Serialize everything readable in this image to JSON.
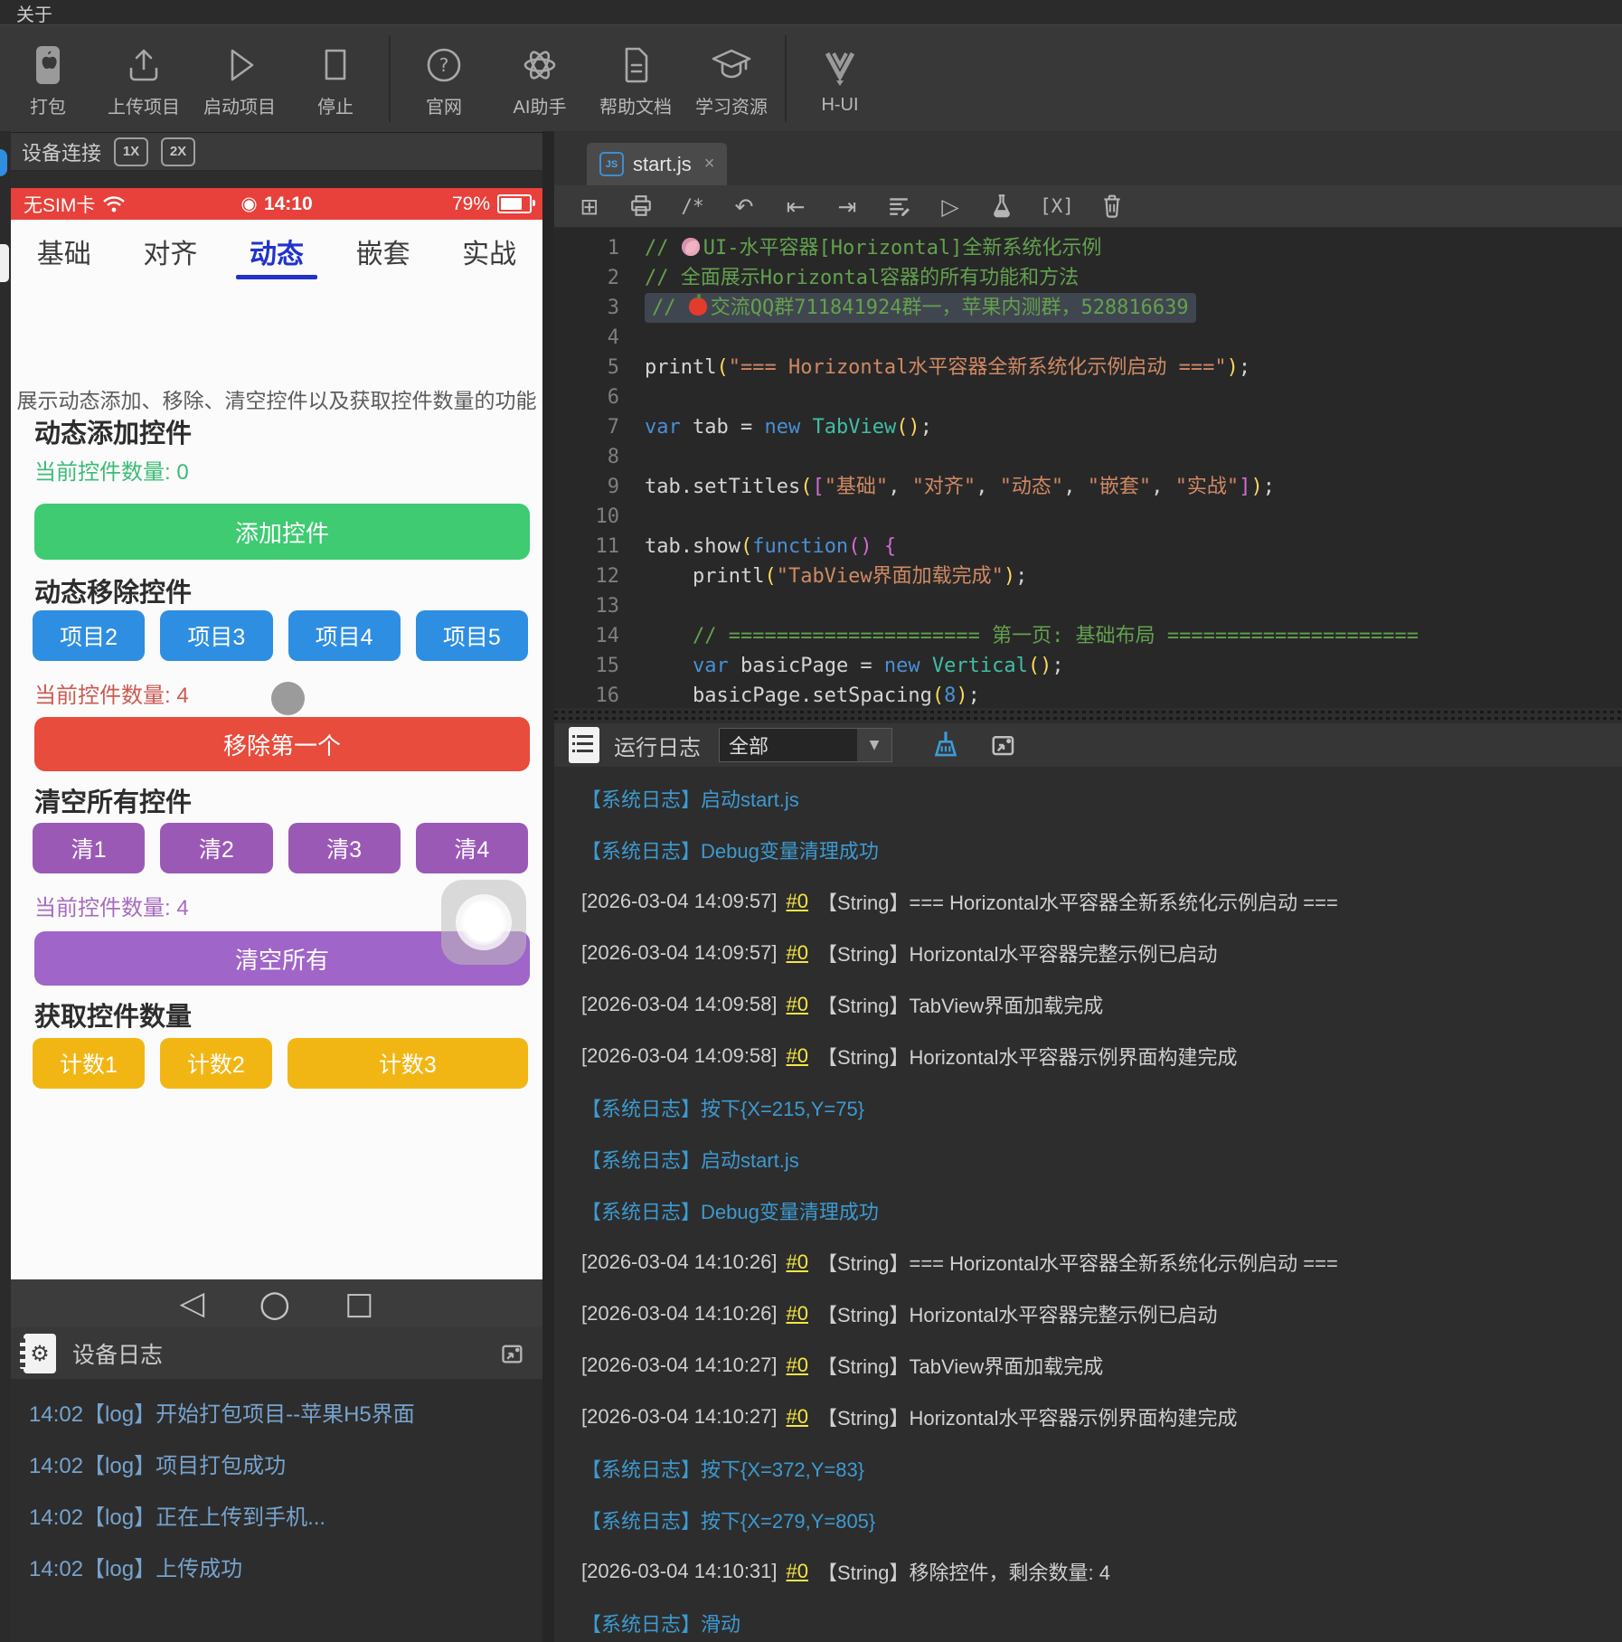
{
  "menu_bar": {
    "about": "关于"
  },
  "toolbar": {
    "items": [
      {
        "label": "打包",
        "icon": "apple-icon"
      },
      {
        "label": "上传项目",
        "icon": "upload-icon"
      },
      {
        "label": "启动项目",
        "icon": "play-icon"
      },
      {
        "label": "停止",
        "icon": "stop-icon"
      },
      {
        "label": "官网",
        "icon": "question-circle-icon",
        "sep_before": true
      },
      {
        "label": "AI助手",
        "icon": "openai-icon"
      },
      {
        "label": "帮助文档",
        "icon": "doc-icon"
      },
      {
        "label": "学习资源",
        "icon": "graduation-icon"
      },
      {
        "label": "H-UI",
        "icon": "hui-logo-icon",
        "sep_before": true
      }
    ]
  },
  "device_panel": {
    "title": "设备连接",
    "scale_buttons": [
      "1X",
      "2X"
    ],
    "phone": {
      "status_bar": {
        "carrier": "无SIM卡",
        "time": "14:10",
        "battery": "79%"
      },
      "tabs": [
        "基础",
        "对齐",
        "动态",
        "嵌套",
        "实战"
      ],
      "active_tab_index": 2,
      "description": "展示动态添加、移除、清空控件以及获取控件数量的功能",
      "add_section": {
        "title": "动态添加控件",
        "count": "当前控件数量: 0",
        "button": "添加控件"
      },
      "remove_section": {
        "title": "动态移除控件",
        "buttons": [
          "项目2",
          "项目3",
          "项目4",
          "项目5"
        ],
        "count": "当前控件数量: 4",
        "action": "移除第一个"
      },
      "clear_section": {
        "title": "清空所有控件",
        "buttons": [
          "清1",
          "清2",
          "清3",
          "清4"
        ],
        "count": "当前控件数量: 4",
        "action": "清空所有"
      },
      "count_section": {
        "title": "获取控件数量",
        "buttons": [
          "计数1",
          "计数2",
          "计数3"
        ]
      },
      "colors": {
        "statusbar_red": "#e8403a",
        "tab_active_blue": "#2033cc",
        "green_button": "#3ecb71",
        "blue_button": "#2e8ee2",
        "red_button": "#e74c3c",
        "purple_button": "#9b59b6",
        "purple_light_button": "#a065c8",
        "yellow_button": "#f2b614",
        "green_text": "#3cbb75",
        "red_text": "#cc5a52",
        "purple_text": "#a66bbf"
      }
    }
  },
  "device_log": {
    "title": "设备日志",
    "entries": [
      "14:02【log】开始打包项目--苹果H5界面",
      "14:02【log】项目打包成功",
      "14:02【log】正在上传到手机...",
      "14:02【log】上传成功"
    ]
  },
  "editor": {
    "tab_name": "start.js",
    "tab_icon": "js-file-icon",
    "close_label": "×",
    "toolbar_icons": [
      "new-file-icon",
      "print-icon",
      "comment-icon",
      "undo-icon",
      "outdent-icon",
      "indent-icon",
      "format-icon",
      "run-icon",
      "flask-icon",
      "variables-icon",
      "trash-icon"
    ],
    "code_lines": [
      {
        "n": 1,
        "segs": [
          {
            "t": "// ",
            "c": "comment"
          },
          {
            "t": "🎨",
            "c": "emoji-palette"
          },
          {
            "t": "UI-水平容器[Horizontal]全新系统化示例",
            "c": "comment"
          }
        ]
      },
      {
        "n": 2,
        "segs": [
          {
            "t": "// 全面展示Horizontal容器的所有功能和方法",
            "c": "comment"
          }
        ]
      },
      {
        "n": 3,
        "hl": true,
        "segs": [
          {
            "t": "// ",
            "c": "comment"
          },
          {
            "t": "🍎",
            "c": "emoji-apple"
          },
          {
            "t": "交流QQ群711841924群一，苹果内测群，528816639",
            "c": "comment"
          }
        ]
      },
      {
        "n": 4,
        "segs": []
      },
      {
        "n": 5,
        "segs": [
          {
            "t": "printl",
            "c": "plain"
          },
          {
            "t": "(",
            "c": "paren"
          },
          {
            "t": "\"=== Horizontal水平容器全新系统化示例启动 ===\"",
            "c": "str"
          },
          {
            "t": ")",
            "c": "paren"
          },
          {
            "t": ";",
            "c": "plain"
          }
        ]
      },
      {
        "n": 6,
        "segs": []
      },
      {
        "n": 7,
        "segs": [
          {
            "t": "var",
            "c": "kw"
          },
          {
            "t": " tab = ",
            "c": "plain"
          },
          {
            "t": "new",
            "c": "kw"
          },
          {
            "t": " ",
            "c": "plain"
          },
          {
            "t": "TabView",
            "c": "cls"
          },
          {
            "t": "()",
            "c": "paren"
          },
          {
            "t": ";",
            "c": "plain"
          }
        ]
      },
      {
        "n": 8,
        "segs": []
      },
      {
        "n": 9,
        "segs": [
          {
            "t": "tab.setTitles",
            "c": "plain"
          },
          {
            "t": "(",
            "c": "paren"
          },
          {
            "t": "[",
            "c": "bracket"
          },
          {
            "t": "\"基础\"",
            "c": "str"
          },
          {
            "t": ", ",
            "c": "plain"
          },
          {
            "t": "\"对齐\"",
            "c": "str"
          },
          {
            "t": ", ",
            "c": "plain"
          },
          {
            "t": "\"动态\"",
            "c": "str"
          },
          {
            "t": ", ",
            "c": "plain"
          },
          {
            "t": "\"嵌套\"",
            "c": "str"
          },
          {
            "t": ", ",
            "c": "plain"
          },
          {
            "t": "\"实战\"",
            "c": "str"
          },
          {
            "t": "]",
            "c": "bracket"
          },
          {
            "t": ")",
            "c": "paren"
          },
          {
            "t": ";",
            "c": "plain"
          }
        ]
      },
      {
        "n": 10,
        "segs": []
      },
      {
        "n": 11,
        "segs": [
          {
            "t": "tab.show",
            "c": "plain"
          },
          {
            "t": "(",
            "c": "paren"
          },
          {
            "t": "function",
            "c": "kw"
          },
          {
            "t": "()",
            "c": "bracket"
          },
          {
            "t": " {",
            "c": "bracket"
          }
        ]
      },
      {
        "n": 12,
        "segs": [
          {
            "t": "    printl",
            "c": "plain"
          },
          {
            "t": "(",
            "c": "paren"
          },
          {
            "t": "\"TabView界面加载完成\"",
            "c": "str"
          },
          {
            "t": ")",
            "c": "paren"
          },
          {
            "t": ";",
            "c": "plain"
          }
        ]
      },
      {
        "n": 13,
        "segs": []
      },
      {
        "n": 14,
        "segs": [
          {
            "t": "    ",
            "c": "plain"
          },
          {
            "t": "// ===================== 第一页: 基础布局 =====================",
            "c": "comment"
          }
        ]
      },
      {
        "n": 15,
        "segs": [
          {
            "t": "    ",
            "c": "plain"
          },
          {
            "t": "var",
            "c": "kw"
          },
          {
            "t": " basicPage = ",
            "c": "plain"
          },
          {
            "t": "new",
            "c": "kw"
          },
          {
            "t": " ",
            "c": "plain"
          },
          {
            "t": "Vertical",
            "c": "cls"
          },
          {
            "t": "()",
            "c": "paren"
          },
          {
            "t": ";",
            "c": "plain"
          }
        ]
      },
      {
        "n": 16,
        "segs": [
          {
            "t": "    basicPage.setSpacing",
            "c": "plain"
          },
          {
            "t": "(",
            "c": "paren"
          },
          {
            "t": "8",
            "c": "num"
          },
          {
            "t": ")",
            "c": "paren"
          },
          {
            "t": ";",
            "c": "plain"
          }
        ]
      }
    ]
  },
  "run_log": {
    "title": "运行日志",
    "filter_value": "全部",
    "entries": [
      {
        "type": "system",
        "text": "【系统日志】启动start.js"
      },
      {
        "type": "system",
        "text": "【系统日志】Debug变量清理成功"
      },
      {
        "type": "print",
        "time": "[2026-03-04 14:09:57]",
        "ref": "#0",
        "text": "【String】=== Horizontal水平容器全新系统化示例启动 ==="
      },
      {
        "type": "print",
        "time": "[2026-03-04 14:09:57]",
        "ref": "#0",
        "text": "【String】Horizontal水平容器完整示例已启动"
      },
      {
        "type": "print",
        "time": "[2026-03-04 14:09:58]",
        "ref": "#0",
        "text": "【String】TabView界面加载完成"
      },
      {
        "type": "print",
        "time": "[2026-03-04 14:09:58]",
        "ref": "#0",
        "text": "【String】Horizontal水平容器示例界面构建完成"
      },
      {
        "type": "system",
        "text": "【系统日志】按下{X=215,Y=75}"
      },
      {
        "type": "system",
        "text": "【系统日志】启动start.js"
      },
      {
        "type": "system",
        "text": "【系统日志】Debug变量清理成功"
      },
      {
        "type": "print",
        "time": "[2026-03-04 14:10:26]",
        "ref": "#0",
        "text": "【String】=== Horizontal水平容器全新系统化示例启动 ==="
      },
      {
        "type": "print",
        "time": "[2026-03-04 14:10:26]",
        "ref": "#0",
        "text": "【String】Horizontal水平容器完整示例已启动"
      },
      {
        "type": "print",
        "time": "[2026-03-04 14:10:27]",
        "ref": "#0",
        "text": "【String】TabView界面加载完成"
      },
      {
        "type": "print",
        "time": "[2026-03-04 14:10:27]",
        "ref": "#0",
        "text": "【String】Horizontal水平容器示例界面构建完成"
      },
      {
        "type": "system",
        "text": "【系统日志】按下{X=372,Y=83}"
      },
      {
        "type": "system",
        "text": "【系统日志】按下{X=279,Y=805}"
      },
      {
        "type": "print",
        "time": "[2026-03-04 14:10:31]",
        "ref": "#0",
        "text": "【String】移除控件，剩余数量: 4"
      },
      {
        "type": "system",
        "text": "【系统日志】滑动"
      }
    ]
  }
}
